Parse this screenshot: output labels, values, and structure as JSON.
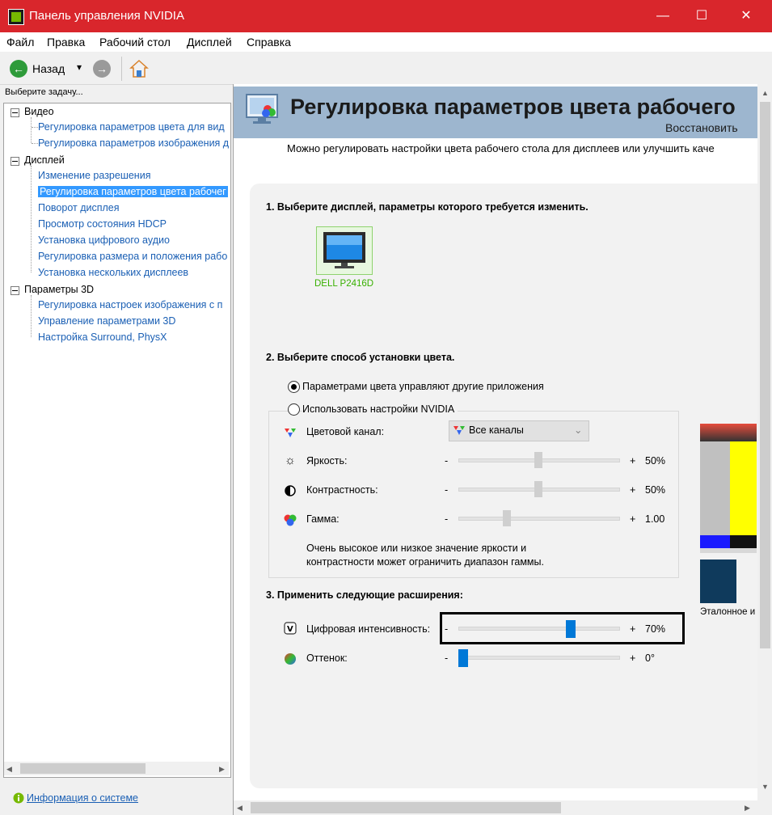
{
  "window": {
    "title": "Панель управления NVIDIA",
    "minimize": "—",
    "maximize": "☐",
    "close": "✕"
  },
  "menu": [
    "Файл",
    "Правка",
    "Рабочий стол",
    "Дисплей",
    "Справка"
  ],
  "toolbar": {
    "back_label": "Назад",
    "dropdown": "▾"
  },
  "left": {
    "task_label": "Выберите задачу...",
    "groups": [
      {
        "label": "Видео",
        "items": [
          "Регулировка параметров цвета для вид",
          "Регулировка параметров изображения д"
        ]
      },
      {
        "label": "Дисплей",
        "items": [
          "Изменение разрешения",
          "Регулировка параметров цвета рабочег",
          "Поворот дисплея",
          "Просмотр состояния HDCP",
          "Установка цифрового аудио",
          "Регулировка размера и положения рабо",
          "Установка нескольких дисплеев"
        ]
      },
      {
        "label": "Параметры 3D",
        "items": [
          "Регулировка настроек изображения с п",
          "Управление параметрами 3D",
          "Настройка Surround, PhysX"
        ]
      }
    ],
    "selected_item": "Регулировка параметров цвета рабочег",
    "sysinfo": "Информация о системе"
  },
  "page": {
    "title": "Регулировка параметров цвета рабочего",
    "restore": "Восстановить",
    "description": "Можно регулировать настройки цвета рабочего стола для дисплеев или улучшить каче",
    "step1": "1. Выберите дисплей, параметры которого требуется изменить.",
    "display_name": "DELL P2416D",
    "step2": "2. Выберите способ установки цвета.",
    "radio_other": "Параметрами цвета управляют другие приложения",
    "radio_nvidia": "Использовать настройки NVIDIA",
    "channel_label": "Цветовой канал:",
    "channel_value": "Все каналы",
    "minus": "-",
    "plus": "+",
    "brightness_label": "Яркость:",
    "brightness_value": "50%",
    "brightness_level": 0.5,
    "contrast_label": "Контрастность:",
    "contrast_value": "50%",
    "contrast_level": 0.5,
    "gamma_label": "Гамма:",
    "gamma_value": "1.00",
    "warning_line1": "Очень высокое или низкое значение яркости и",
    "warning_line2": "контрастности может ограничить диапазон гаммы.",
    "step3": "3. Применить следующие расширения:",
    "vibrance_label": "Цифровая интенсивность:",
    "vibrance_value": "70%",
    "vibrance_level": 0.7,
    "hue_label": "Оттенок:",
    "hue_value": "0°",
    "hue_level": 0.0,
    "reference_label": "Эталонное и"
  },
  "colors": {
    "titlebar": "#d9262c",
    "link": "#1a5fb4",
    "selection": "#3399ff",
    "header": "#9db6cf",
    "nvidia_green": "#76b900",
    "accent": "#0078d7"
  }
}
